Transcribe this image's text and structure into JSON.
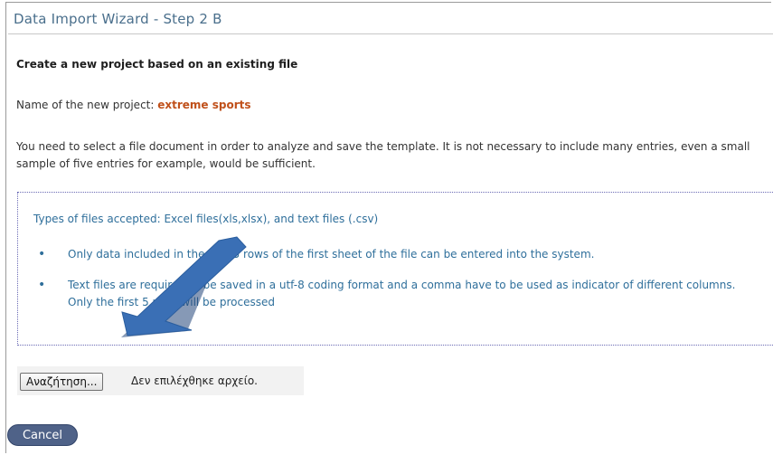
{
  "wizard": {
    "title": "Data Import Wizard - Step 2 B",
    "subtitle": "Create a new project based on an existing file",
    "project_label": "Name of the new project: ",
    "project_name": "extreme sports",
    "intro": "You need to select a file document in order to analyze and save the template. It is not necessary to include many entries, even a small sample of five entries for example, would be sufficient."
  },
  "info": {
    "accepted": "Types of files accepted: Excel files(xls,xlsx), and text files (.csv)",
    "bullets": [
      "Only data included in the first 5 rows of the first sheet of the file can be entered into the system.",
      "Text files are required to be saved in a utf-8 coding format and a comma have to be used as indicator of different columns. Only the first 5 rows will be processed"
    ]
  },
  "file_input": {
    "browse_label": "Αναζήτηση...",
    "status": "Δεν επιλέχθηκε αρχείο."
  },
  "actions": {
    "cancel_label": "Cancel"
  },
  "colors": {
    "title": "#4a6f8c",
    "project_name": "#c0501a",
    "info_text": "#2f6f9b",
    "cancel_bg": "#4f6288",
    "arrow": "#3a6fb5"
  }
}
